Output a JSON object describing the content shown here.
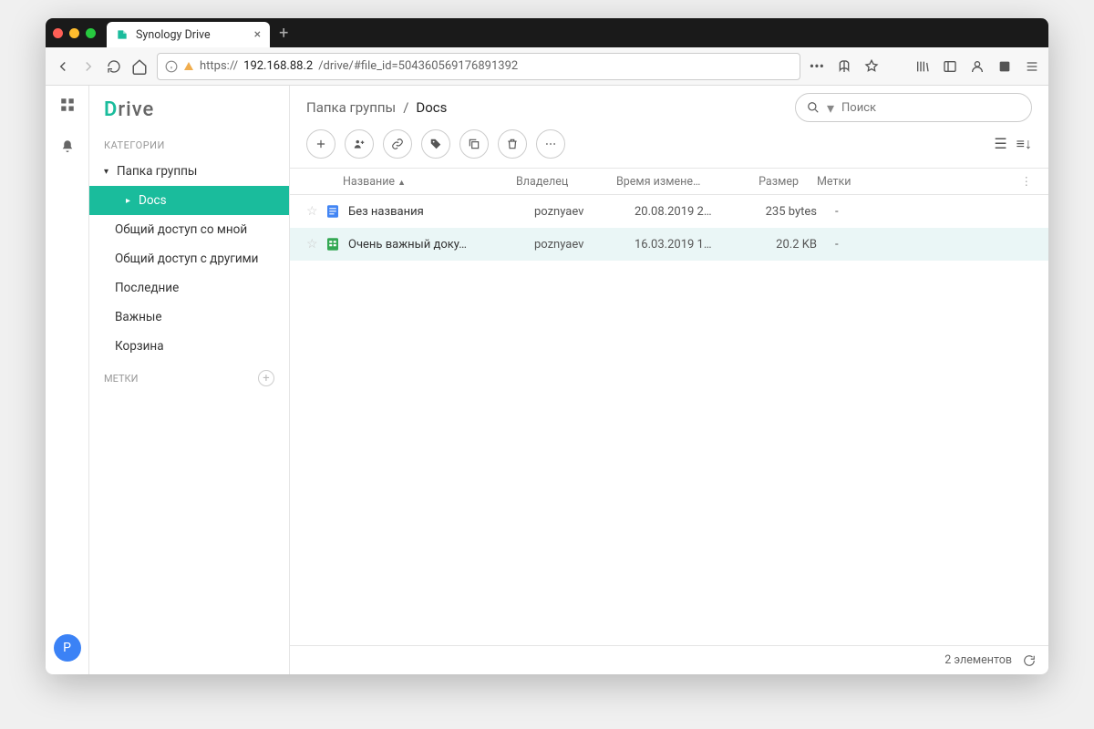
{
  "browser": {
    "tab_title": "Synology Drive",
    "url_prefix": "https://",
    "url_host": "192.168.88.2",
    "url_path": "/drive/#file_id=504360569176891392"
  },
  "app": {
    "logo_prefix": "D",
    "logo_rest": "rive",
    "avatar_letter": "P"
  },
  "sidebar": {
    "categories_label": "КАТЕГОРИИ",
    "labels_label": "МЕТКИ",
    "items": [
      {
        "label": "Папка группы",
        "expanded": true
      },
      {
        "label": "Docs",
        "active": true
      },
      {
        "label": "Общий доступ со мной"
      },
      {
        "label": "Общий доступ с другими"
      },
      {
        "label": "Последние"
      },
      {
        "label": "Важные"
      },
      {
        "label": "Корзина"
      }
    ]
  },
  "breadcrumb": {
    "root": "Папка группы",
    "sep": "/",
    "current": "Docs"
  },
  "search": {
    "placeholder": "Поиск"
  },
  "columns": {
    "name": "Название",
    "owner": "Владелец",
    "time": "Время измене…",
    "size": "Размер",
    "labels": "Метки",
    "sort": "▲"
  },
  "files": [
    {
      "icon": "doc",
      "name": "Без названия",
      "owner": "poznyaev",
      "time": "20.08.2019 2…",
      "size": "235 bytes",
      "labels": "-",
      "selected": false
    },
    {
      "icon": "sheet",
      "name": "Очень важный доку…",
      "owner": "poznyaev",
      "time": "16.03.2019 1…",
      "size": "20.2 KB",
      "labels": "-",
      "selected": true
    }
  ],
  "status": {
    "count": "2 элементов"
  }
}
